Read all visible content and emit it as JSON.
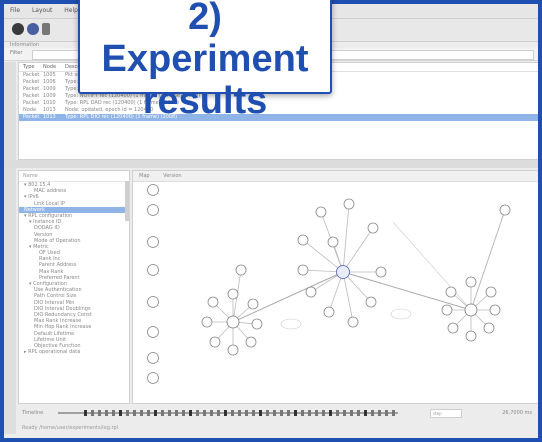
{
  "banner": {
    "line1": "2) Experiment",
    "line2": "results"
  },
  "menu": [
    "File",
    "Layout",
    "Help"
  ],
  "window": {
    "subtitle": "Information"
  },
  "filter": {
    "label": "Filter"
  },
  "events": {
    "headers": [
      "Type",
      "Node",
      "Description"
    ],
    "rows": [
      {
        "type": "Packet",
        "node": "1005",
        "desc": "Pkt sent",
        "sel": false
      },
      {
        "type": "Packet",
        "node": "1006",
        "desc": "Type: updated, epoch id = 12345 (1 frame)",
        "sel": false
      },
      {
        "type": "Packet",
        "node": "1009",
        "desc": "Type: updated, epoch id = 12345 (1 frame)",
        "sel": false
      },
      {
        "type": "Packet",
        "node": "1009",
        "desc": "Type: NOTIFY rec (120400) (1 frame) (3 frame) (2008)",
        "sel": false
      },
      {
        "type": "Packet",
        "node": "1010",
        "desc": "Type: RPL DAO rec (120400) (1 frame) (2008)",
        "sel": false
      },
      {
        "type": "Node",
        "node": "1013",
        "desc": "Node: updated, epoch id = 120400",
        "sel": false
      },
      {
        "type": "Packet",
        "node": "1013",
        "desc": "Type: RPL DIO rec (120400) (1 frame) (2008)",
        "sel": true
      }
    ]
  },
  "tree": {
    "header": "Name",
    "items": [
      {
        "label": "▾ 802.15.4",
        "indent": 1
      },
      {
        "label": "MAC address",
        "indent": 3
      },
      {
        "label": "▾ IPv6",
        "indent": 1
      },
      {
        "label": "Link Local IP",
        "indent": 3
      },
      {
        "label": "Network",
        "indent": 1,
        "sel": true
      },
      {
        "label": "▾ RPL configuration",
        "indent": 1
      },
      {
        "label": "▾ Instance ID",
        "indent": 2
      },
      {
        "label": "DODAG ID",
        "indent": 3
      },
      {
        "label": "Version",
        "indent": 3
      },
      {
        "label": "Mode of Operation",
        "indent": 3
      },
      {
        "label": "▾ Metric",
        "indent": 2
      },
      {
        "label": "OF Used",
        "indent": 4
      },
      {
        "label": "Rank Inc",
        "indent": 4
      },
      {
        "label": "Parent Address",
        "indent": 4
      },
      {
        "label": "Max Rank",
        "indent": 4
      },
      {
        "label": "Preferred Parent",
        "indent": 4
      },
      {
        "label": "▾ Configuration",
        "indent": 2
      },
      {
        "label": "Use Authentication",
        "indent": 3
      },
      {
        "label": "Path Control Size",
        "indent": 3
      },
      {
        "label": "DIO Interval Min",
        "indent": 3
      },
      {
        "label": "DIO Interval Doublings",
        "indent": 3
      },
      {
        "label": "DIO Redundancy Const",
        "indent": 3
      },
      {
        "label": "Max Rank Increase",
        "indent": 3
      },
      {
        "label": "Min Hop Rank Increase",
        "indent": 3
      },
      {
        "label": "Default Lifetime",
        "indent": 3
      },
      {
        "label": "Lifetime Unit",
        "indent": 3
      },
      {
        "label": "Objective Function",
        "indent": 3
      },
      {
        "label": "▸ RPL operational data",
        "indent": 1
      }
    ]
  },
  "graph": {
    "tabs": [
      "Map",
      "Version"
    ]
  },
  "timeline": {
    "label": "Timeline",
    "step": "step",
    "time": "26,7000 ms"
  },
  "status": {
    "text": "Ready  /home/user/experiments/log.rpl"
  }
}
